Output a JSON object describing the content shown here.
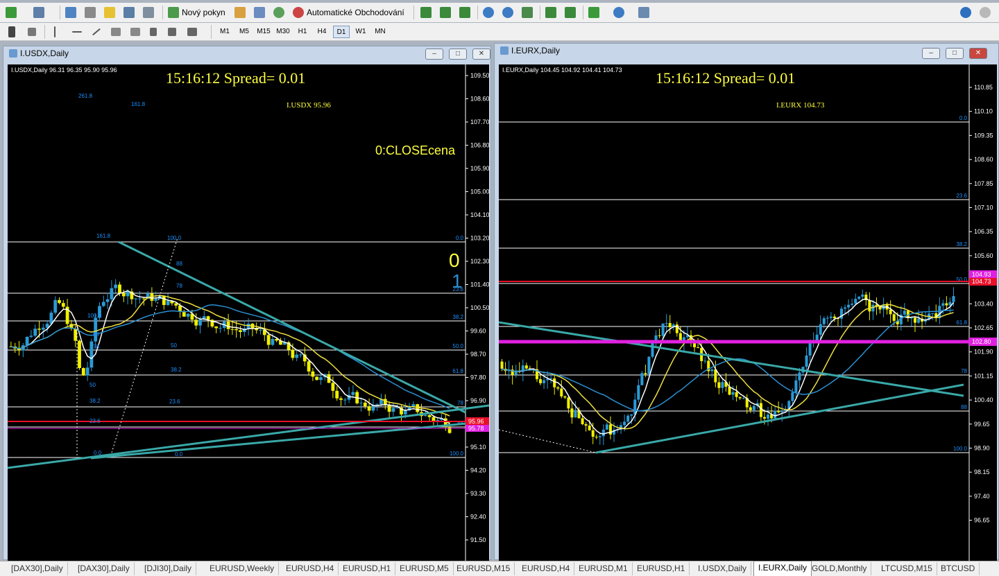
{
  "toolbar": {
    "new_order_label": "Nový pokyn",
    "auto_trading_label": "Automatické Obchodování",
    "timeframes": [
      "M1",
      "M5",
      "M15",
      "M30",
      "H1",
      "H4",
      "D1",
      "W1",
      "MN"
    ],
    "selected_timeframe": "D1"
  },
  "windows": [
    {
      "title": "I.USDX,Daily",
      "header": "I.USDX,Daily  96.31 96.35 95.90 95.96",
      "clock": "15:16:12  Spread= 0.01",
      "symbol_label": "I.USDX  95.96",
      "indicator_label": "0:CLOSEcena",
      "big_digits": [
        "0",
        "1"
      ],
      "price_axis": [
        "109.50",
        "108.60",
        "107.70",
        "106.80",
        "105.90",
        "105.00",
        "104.10",
        "103.20",
        "102.30",
        "101.40",
        "100.50",
        "99.60",
        "98.70",
        "97.80",
        "96.90",
        "96.00",
        "95.10",
        "94.20",
        "93.30",
        "92.40",
        "91.50"
      ],
      "current_price": "95.96",
      "lower_price": "95.78",
      "fib_levels": [
        "0.0",
        "23.6",
        "38.2",
        "50.0",
        "61.8",
        "78",
        "88",
        "100.0"
      ],
      "fib_left_labels": [
        "261.8",
        "161.8",
        "161.8",
        "100.0",
        "88",
        "78",
        "50",
        "38.2",
        "23.6",
        "0.0"
      ],
      "fib_mid_labels": [
        "100.0",
        "88",
        "78",
        "50",
        "38.2",
        "23.6",
        "0.0"
      ]
    },
    {
      "title": "I.EURX,Daily",
      "header": "I.EURX,Daily  104.45 104.92 104.41 104.73",
      "clock": "15:16:12  Spread= 0.01",
      "symbol_label": "I.EURX  104.73",
      "price_axis": [
        "110.85",
        "110.10",
        "109.35",
        "108.60",
        "107.85",
        "107.10",
        "106.35",
        "105.60",
        "104.10",
        "103.40",
        "102.65",
        "101.90",
        "101.15",
        "100.40",
        "99.65",
        "98.90",
        "98.15",
        "97.40",
        "96.65"
      ],
      "current_price": "104.73",
      "high_price": "104.93",
      "magenta_price": "102.80",
      "fib_levels": [
        "0.0",
        "23.6",
        "38.2",
        "50.0",
        "61.8",
        "78",
        "88",
        "100.0"
      ]
    }
  ],
  "tabs": [
    "[DAX30],Daily",
    "[DAX30],Daily",
    "[DJI30],Daily",
    "EURUSD,Weekly",
    "EURUSD,H4",
    "EURUSD,H1",
    "EURUSD,M5",
    "EURUSD,M15",
    "EURUSD,H4",
    "EURUSD,M1",
    "EURUSD,H1",
    "I.USDX,Daily",
    "I.EURX,Daily",
    "GOLD,Monthly",
    "LTCUSD,M15",
    "BTCUSD"
  ],
  "active_tab": "I.EURX,Daily",
  "colors": {
    "bull": "#2a9bd6",
    "bear": "#f0f000",
    "ma_fast": "#ffffff",
    "ma_slow": "#f0e040",
    "ma_long": "#2a8fd0",
    "trend": "#3aa8a8",
    "red_line": "#e8102a",
    "magenta": "#e020e0",
    "fib": "#1e90ff",
    "text_yellow": "#ffff40"
  }
}
